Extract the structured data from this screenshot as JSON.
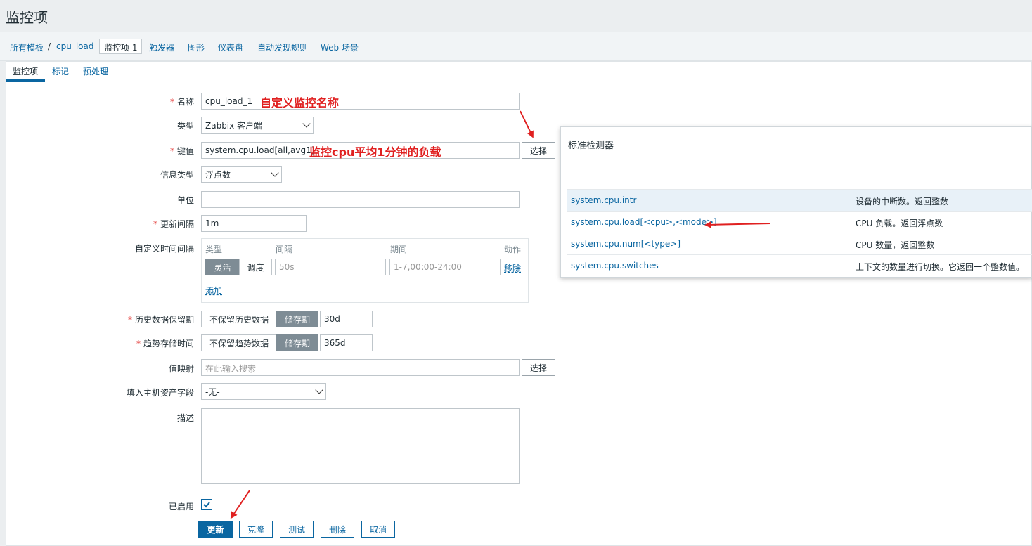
{
  "page_title": "监控项",
  "breadcrumb": {
    "all_templates": "所有模板",
    "sep": "/",
    "template": "cpu_load",
    "items_active": "监控项 1",
    "triggers": "触发器",
    "graphs": "图形",
    "dashboards": "仪表盘",
    "discovery": "自动发现规则",
    "web": "Web 场景"
  },
  "tabs": [
    "监控项",
    "标记",
    "预处理"
  ],
  "form": {
    "required_mark": "*",
    "name_label": "名称",
    "name_value": "cpu_load_1",
    "type_label": "类型",
    "type_value": "Zabbix 客户端",
    "key_label": "键值",
    "key_value": "system.cpu.load[all,avg1]",
    "select_btn": "选择",
    "info_type_label": "信息类型",
    "info_type_value": "浮点数",
    "units_label": "单位",
    "units_value": "",
    "interval_label": "更新间隔",
    "interval_value": "1m",
    "custom_intervals_label": "自定义时间间隔",
    "custom_intervals": {
      "col_type": "类型",
      "col_interval": "间隔",
      "col_period": "期间",
      "col_action": "动作",
      "flexible": "灵活",
      "scheduling": "调度",
      "interval_placeholder": "50s",
      "period_placeholder": "1-7,00:00-24:00",
      "remove": "移除",
      "add": "添加"
    },
    "history_label": "历史数据保留期",
    "history_no_keep": "不保留历史数据",
    "history_keep": "储存期",
    "history_value": "30d",
    "trends_label": "趋势存储时间",
    "trends_no_keep": "不保留趋势数据",
    "trends_keep": "储存期",
    "trends_value": "365d",
    "valuemap_label": "值映射",
    "valuemap_placeholder": "在此输入搜索",
    "inventory_label": "填入主机资产字段",
    "inventory_value": "-无-",
    "desc_label": "描述",
    "desc_value": "",
    "enabled_label": "已启用",
    "enabled": true
  },
  "buttons": {
    "update": "更新",
    "clone": "克隆",
    "test": "测试",
    "delete": "删除",
    "cancel": "取消"
  },
  "annotations": {
    "name_note": "自定义监控名称",
    "key_note": "监控cpu平均1分钟的负载"
  },
  "popup": {
    "title": "标准检测器",
    "rows": [
      {
        "key": "system.cpu.intr",
        "desc": "设备的中断数。返回整数"
      },
      {
        "key": "system.cpu.load[<cpu>,<mode>]",
        "desc": "CPU 负载。返回浮点数"
      },
      {
        "key": "system.cpu.num[<type>]",
        "desc": "CPU 数量，返回整数"
      },
      {
        "key": "system.cpu.switches",
        "desc": "上下文的数量进行切换。它返回一个整数值。"
      }
    ]
  },
  "colors": {
    "accent": "#0a66a1",
    "annotation": "#e02020",
    "required": "#e33734"
  }
}
